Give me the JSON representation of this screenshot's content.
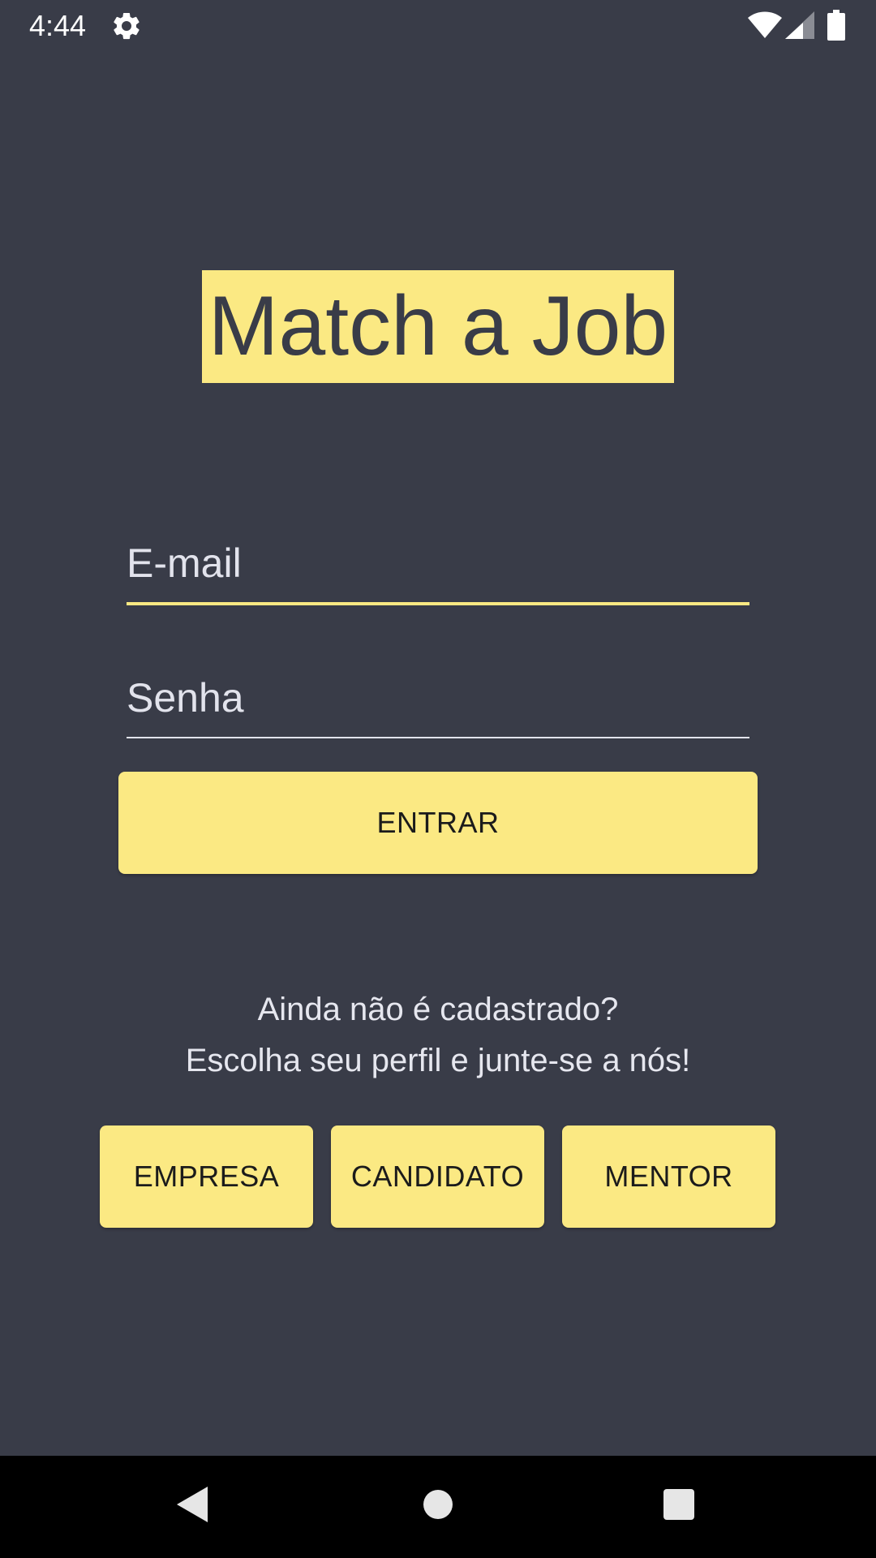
{
  "status_bar": {
    "time": "4:44",
    "icons": [
      "gear-icon",
      "wifi-icon",
      "signal-icon",
      "battery-icon"
    ]
  },
  "app": {
    "title": "Match a Job"
  },
  "login": {
    "email_placeholder": "E-mail",
    "email_value": "",
    "password_placeholder": "Senha",
    "password_value": "",
    "enter_label": "ENTRAR"
  },
  "signup": {
    "line_1": "Ainda não é cadastrado?",
    "line_2": "Escolha seu perfil e junte-se a nós!",
    "roles": [
      "EMPRESA",
      "CANDIDATO",
      "MENTOR"
    ]
  },
  "nav_bar": {
    "icons": [
      "back-icon",
      "home-icon",
      "recents-icon"
    ]
  },
  "colors": {
    "background": "#393c48",
    "accent": "#fbe983",
    "text_light": "#e6e7ef",
    "button_text": "#1b1b1b",
    "nav_background": "#000000"
  }
}
